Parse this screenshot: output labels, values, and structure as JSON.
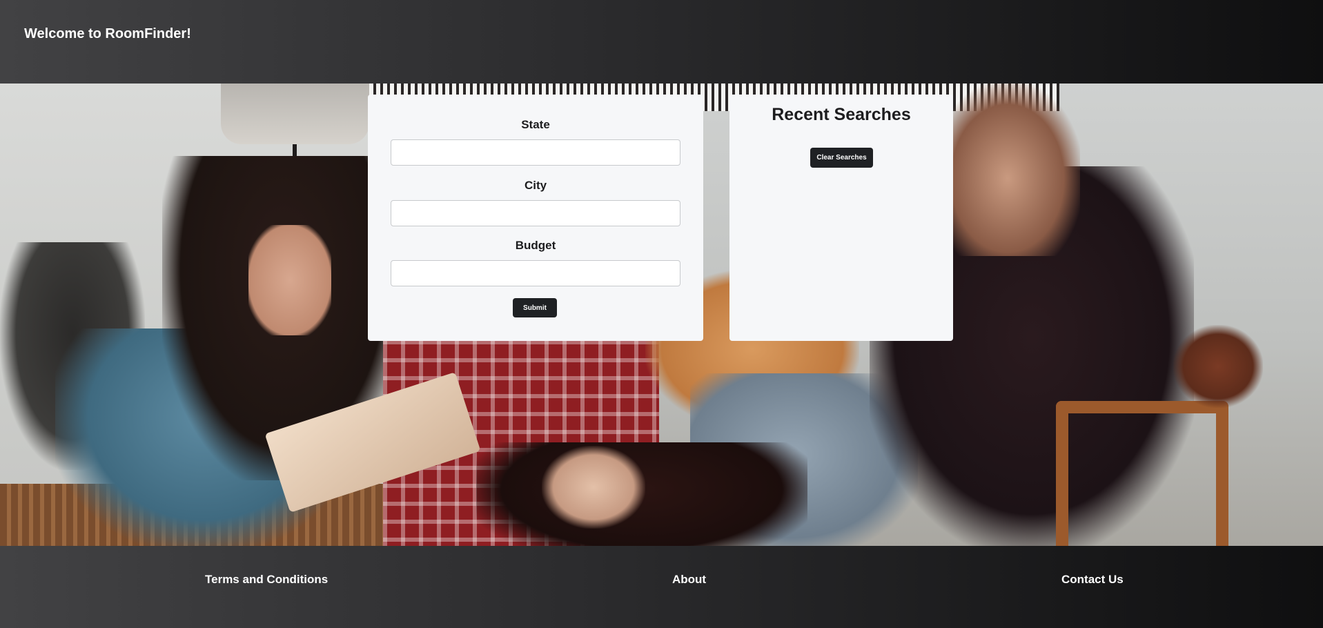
{
  "header": {
    "title": "Welcome to RoomFinder!"
  },
  "hero": {
    "image": "friends-on-couch-photo"
  },
  "search_form": {
    "fields": [
      {
        "label": "State",
        "value": "",
        "placeholder": ""
      },
      {
        "label": "City",
        "value": "",
        "placeholder": ""
      },
      {
        "label": "Budget",
        "value": "",
        "placeholder": ""
      }
    ],
    "submit_label": "Submit"
  },
  "recent_searches": {
    "title": "Recent Searches",
    "clear_label": "Clear Searches"
  },
  "footer": {
    "links": [
      "Terms and Conditions",
      "About",
      "Contact Us"
    ]
  },
  "colors": {
    "header_start": "#424244",
    "header_end": "#0f0f10",
    "card_bg": "#f6f7f9",
    "button_bg": "#1f2124",
    "text_light": "#ffffff",
    "text_dark": "#1d1d1f"
  }
}
